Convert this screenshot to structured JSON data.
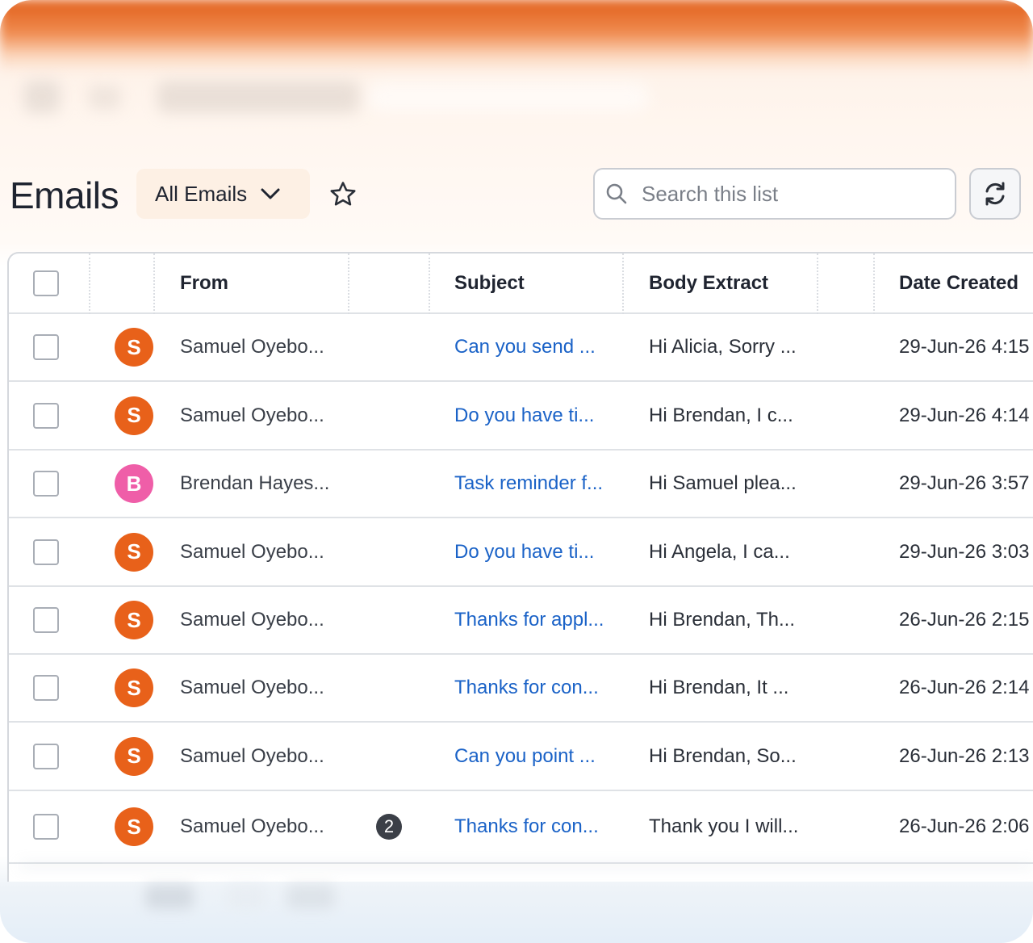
{
  "header": {
    "title": "Emails",
    "view_selector": "All Emails",
    "search_placeholder": "Search this list"
  },
  "table": {
    "columns": [
      "From",
      "Subject",
      "Body Extract",
      "Date Created"
    ],
    "rows": [
      {
        "avatar": "S",
        "avatar_color": "#e8611a",
        "from": "Samuel Oyebo...",
        "count": "",
        "subject": "Can you send ...",
        "body": "Hi Alicia, Sorry ...",
        "date": "29-Jun-26 4:15"
      },
      {
        "avatar": "S",
        "avatar_color": "#e8611a",
        "from": "Samuel Oyebo...",
        "count": "",
        "subject": "Do you have ti...",
        "body": "Hi Brendan, I c...",
        "date": "29-Jun-26 4:14"
      },
      {
        "avatar": "B",
        "avatar_color": "#ef5ea8",
        "from": "Brendan Hayes...",
        "count": "",
        "subject": "Task reminder f...",
        "body": "Hi Samuel plea...",
        "date": "29-Jun-26 3:57"
      },
      {
        "avatar": "S",
        "avatar_color": "#e8611a",
        "from": "Samuel Oyebo...",
        "count": "",
        "subject": "Do you have ti...",
        "body": "Hi Angela, I ca...",
        "date": "29-Jun-26 3:03"
      },
      {
        "avatar": "S",
        "avatar_color": "#e8611a",
        "from": "Samuel Oyebo...",
        "count": "",
        "subject": "Thanks for appl...",
        "body": "Hi Brendan, Th...",
        "date": "26-Jun-26 2:15"
      },
      {
        "avatar": "S",
        "avatar_color": "#e8611a",
        "from": "Samuel Oyebo...",
        "count": "",
        "subject": "Thanks for con...",
        "body": "Hi Brendan, It ...",
        "date": "26-Jun-26 2:14"
      },
      {
        "avatar": "S",
        "avatar_color": "#e8611a",
        "from": "Samuel Oyebo...",
        "count": "",
        "subject": "Can you point ...",
        "body": "Hi Brendan, So...",
        "date": "26-Jun-26 2:13"
      },
      {
        "avatar": "S",
        "avatar_color": "#e8611a",
        "from": "Samuel Oyebo...",
        "count": "2",
        "subject": "Thanks for con...",
        "body": "Thank you I will...",
        "date": "26-Jun-26 2:06"
      }
    ]
  },
  "icons": {
    "view_chevron": "chevron-down-icon",
    "favorite": "star-icon",
    "search": "search-icon",
    "refresh": "refresh-icon"
  }
}
